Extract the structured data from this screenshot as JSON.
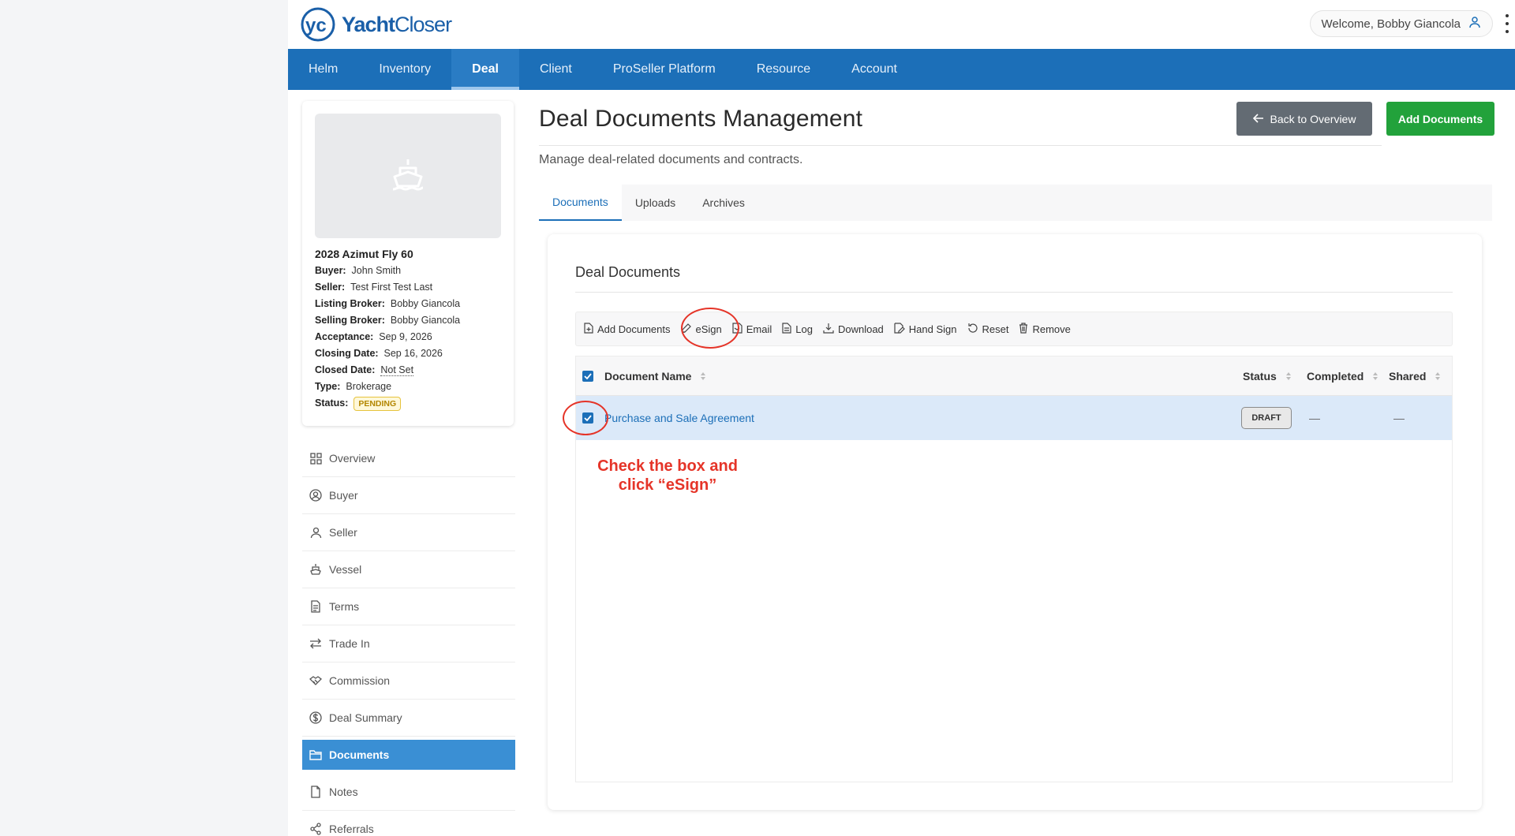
{
  "header": {
    "logo_text_bold": "Yacht",
    "logo_text_thin": "Closer",
    "logo_badge": "yc",
    "welcome": "Welcome, Bobby Giancola"
  },
  "nav": {
    "items": [
      "Helm",
      "Inventory",
      "Deal",
      "Client",
      "ProSeller Platform",
      "Resource",
      "Account"
    ],
    "active": "Deal"
  },
  "deal": {
    "title": "2028 Azimut Fly 60",
    "fields": [
      {
        "label": "Buyer:",
        "value": "John Smith"
      },
      {
        "label": "Seller:",
        "value": "Test First Test Last"
      },
      {
        "label": "Listing Broker:",
        "value": "Bobby Giancola"
      },
      {
        "label": "Selling Broker:",
        "value": "Bobby Giancola"
      },
      {
        "label": "Acceptance:",
        "value": "Sep 9, 2026"
      },
      {
        "label": "Closing Date:",
        "value": "Sep 16, 2026"
      },
      {
        "label": "Closed Date:",
        "value": "Not Set"
      },
      {
        "label": "Type:",
        "value": "Brokerage"
      }
    ],
    "status_label": "Status:",
    "status": "PENDING"
  },
  "sidebar": {
    "items": [
      {
        "label": "Overview",
        "icon": "grid-icon"
      },
      {
        "label": "Buyer",
        "icon": "user-circle-icon"
      },
      {
        "label": "Seller",
        "icon": "user-icon"
      },
      {
        "label": "Vessel",
        "icon": "ship-icon"
      },
      {
        "label": "Terms",
        "icon": "document-icon"
      },
      {
        "label": "Trade In",
        "icon": "swap-icon"
      },
      {
        "label": "Commission",
        "icon": "handshake-icon"
      },
      {
        "label": "Deal Summary",
        "icon": "dollar-icon"
      },
      {
        "label": "Documents",
        "icon": "folder-icon",
        "active": true
      },
      {
        "label": "Notes",
        "icon": "note-icon"
      },
      {
        "label": "Referrals",
        "icon": "share-icon"
      }
    ]
  },
  "main": {
    "title": "Deal Documents Management",
    "subtitle": "Manage deal-related documents and contracts.",
    "back_button": "Back to Overview",
    "add_button": "Add Documents",
    "tabs": [
      "Documents",
      "Uploads",
      "Archives"
    ],
    "active_tab": "Documents"
  },
  "panel": {
    "title": "Deal Documents",
    "toolbar": [
      "Add Documents",
      "eSign",
      "Email",
      "Log",
      "Download",
      "Hand Sign",
      "Reset",
      "Remove"
    ],
    "columns": [
      "Document Name",
      "Status",
      "Completed",
      "Shared"
    ],
    "rows": [
      {
        "name": "Purchase and Sale Agreement",
        "status": "DRAFT",
        "completed": "—",
        "shared": "—",
        "checked": true
      }
    ]
  },
  "annotation": {
    "text": "Check the box and\nclick “eSign”",
    "color": "#e53428"
  },
  "colors": {
    "brand_blue": "#1c6fb8",
    "green": "#22a23b",
    "gray_button": "#636b73"
  }
}
